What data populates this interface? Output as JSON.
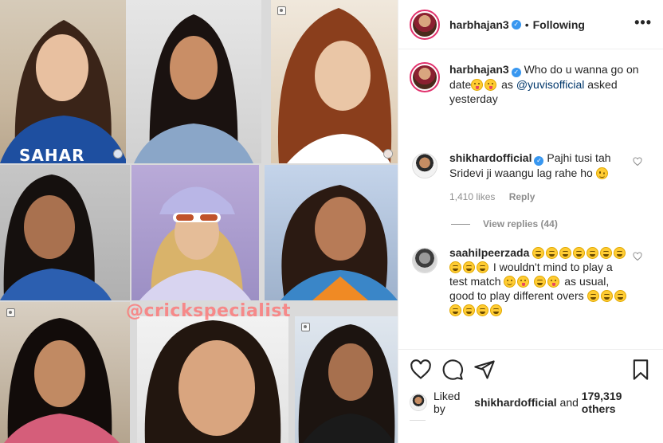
{
  "post": {
    "author": "harbhajan3",
    "separator": "•",
    "follow_status": "Following",
    "more_label": "•••",
    "caption": {
      "username": "harbhajan3",
      "text_before_mention": "Who do u wanna go on date",
      "text_as": "as",
      "mention": "@yuvisofficial",
      "text_after_mention": "asked",
      "time": "yesterday"
    },
    "watermark": "@crickspecialist",
    "jersey_text": "SAHAR"
  },
  "comments": [
    {
      "username": "shikhardofficial",
      "text": "Pajhi tusi tah Sridevi ji waangu lag rahe ho",
      "likes": "1,410 likes",
      "reply_label": "Reply",
      "view_replies": "View replies (44)"
    },
    {
      "username": "saahilpeerzada",
      "text_1": "I wouldn't mind to play a test match",
      "text_2": "as usual, good to play different overs"
    }
  ],
  "liked_by": {
    "prefix": "Liked by",
    "user": "shikhardofficial",
    "and": "and",
    "count": "179,319 others"
  },
  "icons": [
    "heart-icon",
    "comment-icon",
    "share-icon",
    "save-icon",
    "verified-badge-icon",
    "more-options-icon"
  ],
  "colors": {
    "verified": "#3897f0",
    "mention": "#00376b",
    "story_ring": "#e1306c",
    "muted": "#8e8e8e"
  }
}
